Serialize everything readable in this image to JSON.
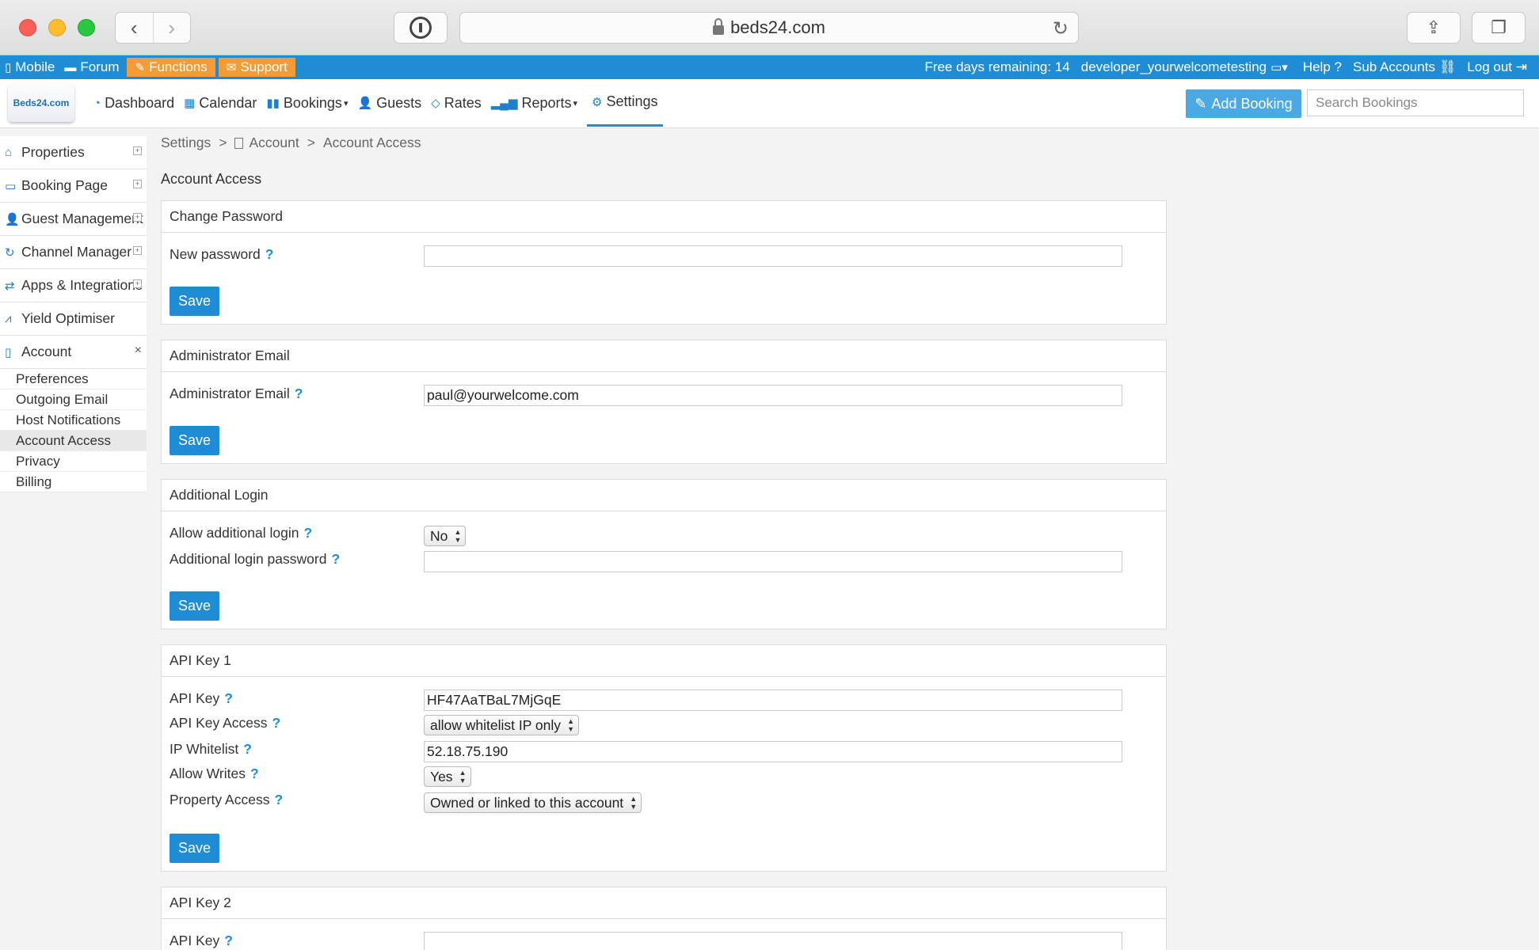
{
  "browser": {
    "url": "beds24.com"
  },
  "topbar": {
    "mobile": "Mobile",
    "forum": "Forum",
    "functions": "Functions",
    "support": "Support",
    "free_days": "Free days remaining: 14",
    "user": "developer_yourwelcometesting",
    "help": "Help",
    "sub_accounts": "Sub Accounts",
    "logout": "Log out"
  },
  "nav": {
    "logo": "Beds24.com",
    "links": [
      "Dashboard",
      "Calendar",
      "Bookings",
      "Guests",
      "Rates",
      "Reports",
      "Settings"
    ],
    "add_booking": "Add Booking",
    "search_placeholder": "Search Bookings"
  },
  "sidebar": {
    "items": [
      "Properties",
      "Booking Page",
      "Guest Management",
      "Channel Manager",
      "Apps & Integrations",
      "Yield Optimiser",
      "Account"
    ],
    "account_sub": [
      "Preferences",
      "Outgoing Email",
      "Host Notifications",
      "Account Access",
      "Privacy",
      "Billing"
    ]
  },
  "breadcrumb": {
    "settings": "Settings",
    "account": "Account",
    "current": "Account Access",
    "sep": ">"
  },
  "page": {
    "title": "Account Access",
    "save_label": "Save",
    "help_mark": "?"
  },
  "change_password": {
    "heading": "Change Password",
    "new_password_label": "New password",
    "new_password_value": ""
  },
  "admin_email": {
    "heading": "Administrator Email",
    "label": "Administrator Email",
    "value": "paul@yourwelcome.com"
  },
  "additional_login": {
    "heading": "Additional Login",
    "allow_label": "Allow additional login",
    "allow_value": "No",
    "password_label": "Additional login password",
    "password_value": ""
  },
  "api_key_1": {
    "heading": "API Key 1",
    "key_label": "API Key",
    "key_value": "HF47AaTBaL7MjGqE",
    "access_label": "API Key Access",
    "access_value": "allow whitelist IP only",
    "whitelist_label": "IP Whitelist",
    "whitelist_value": "52.18.75.190",
    "writes_label": "Allow Writes",
    "writes_value": "Yes",
    "property_label": "Property Access",
    "property_value": "Owned or linked to this account"
  },
  "api_key_2": {
    "heading": "API Key 2",
    "key_label": "API Key",
    "key_value": ""
  },
  "colors": {
    "primary": "#1f8dd6",
    "accent_orange": "#f39c33",
    "add_booking": "#4aa8e2"
  }
}
